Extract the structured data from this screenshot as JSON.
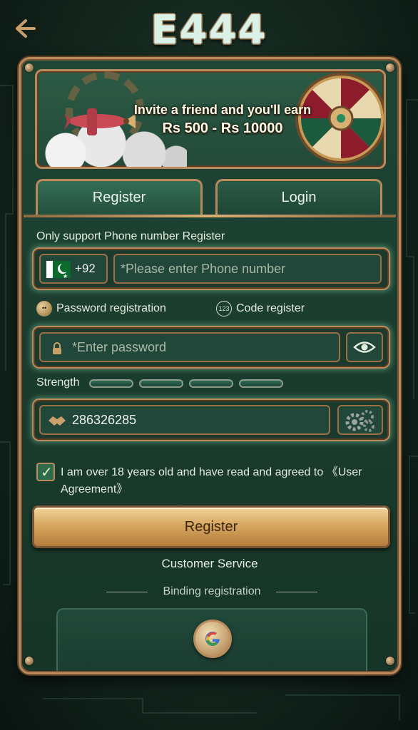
{
  "header": {
    "back_icon": "arrow-left-icon",
    "logo": "E444"
  },
  "banner": {
    "line1": "Invite a friend and you'll earn",
    "line2": "Rs 500 - Rs 10000"
  },
  "tabs": [
    {
      "label": "Register",
      "active": true
    },
    {
      "label": "Login",
      "active": false
    }
  ],
  "form": {
    "note": "Only support Phone number Register",
    "country_code": "+92",
    "phone_placeholder": "*Please enter Phone number",
    "modes": {
      "password": "Password registration",
      "code": "Code register",
      "code_badge": "123"
    },
    "password_placeholder": "*Enter password",
    "strength_label": "Strength",
    "invite_code": "286326285",
    "agree_checked": true,
    "agree_text": "I am over 18 years old and have read and agreed to 《User Agreement》",
    "register_button": "Register"
  },
  "footer": {
    "customer_service": "Customer Service",
    "binding_registration": "Binding registration",
    "google_icon": "google-icon"
  },
  "colors": {
    "panel": "#1f4535",
    "border_bronze": "#b98a5c",
    "button_gold": "#d7a760",
    "text": "#e4ecde"
  }
}
